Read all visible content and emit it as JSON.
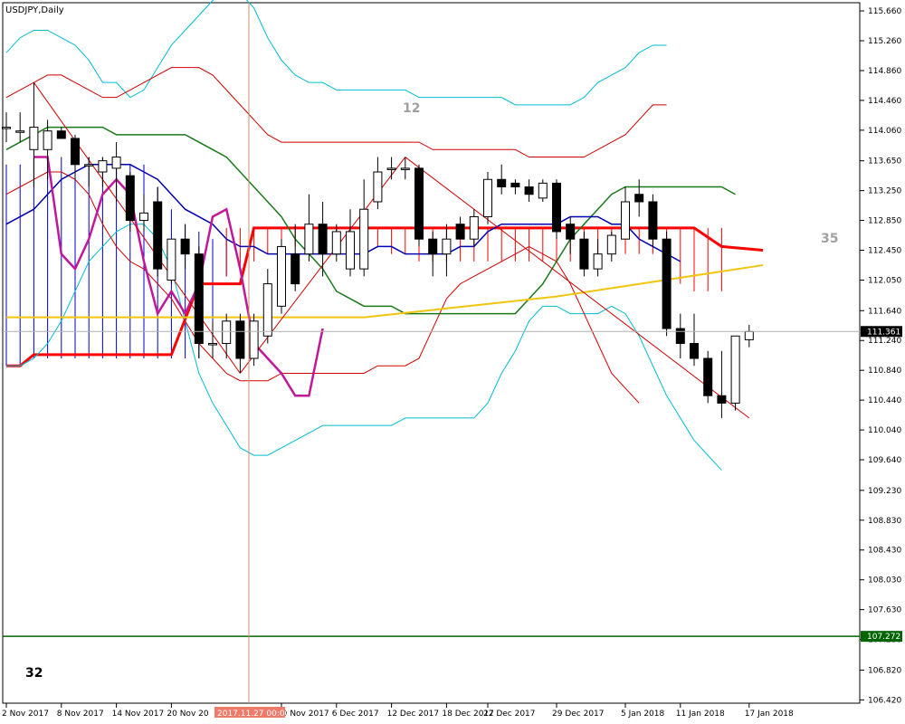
{
  "window": {
    "title": "USDJPY,Daily"
  },
  "colors": {
    "up_candle_fill": "#ffffff",
    "down_candle_fill": "#000000",
    "bollinger_outer": "#00bcd4",
    "bollinger_inner": "#d00000",
    "ma_green": "#1a7a1a",
    "ma_yellow": "#f2c40c",
    "ma_blue": "#0000b0",
    "magenta_line": "#c0189a",
    "cloud_blue": "#0000c8",
    "cloud_red": "#ff0000",
    "crosshair": "#c8906a",
    "support_line": "#006400",
    "price_badge": "#000000"
  },
  "annotations": {
    "label_12": "12",
    "label_35": "35",
    "label_32": "32"
  },
  "current_price_tag": "111.361",
  "support_price_tag": "107.272",
  "crosshair_date_tag": "2017.11.27 00:00",
  "chart_data": {
    "type": "candlestick",
    "title": "USDJPY,Daily",
    "xlabel": "",
    "ylabel": "",
    "ylim": [
      106.4,
      115.6
    ],
    "x_ticks": [
      "2 Nov 2017",
      "8 Nov 2017",
      "14 Nov 2017",
      "20 Nov 20",
      "30 Nov 2017",
      "6 Dec 2017",
      "12 Dec 2017",
      "18 Dec 2017",
      "22 Dec 2017",
      "29 Dec 2017",
      "5 Jan 2018",
      "11 Jan 2018",
      "17 Jan 2018"
    ],
    "y_ticks": [
      "115.660",
      "115.260",
      "114.860",
      "114.460",
      "114.060",
      "113.650",
      "113.250",
      "112.850",
      "112.450",
      "112.050",
      "111.640",
      "111.240",
      "110.840",
      "110.440",
      "110.040",
      "109.640",
      "109.230",
      "108.830",
      "108.430",
      "108.030",
      "107.630",
      "107.230",
      "106.820",
      "106.420"
    ],
    "candles": [
      {
        "o": 114.1,
        "h": 114.3,
        "l": 113.9,
        "c": 114.1
      },
      {
        "o": 114.05,
        "h": 114.3,
        "l": 113.9,
        "c": 114.05
      },
      {
        "o": 113.8,
        "h": 114.7,
        "l": 113.3,
        "c": 114.1
      },
      {
        "o": 113.8,
        "h": 114.2,
        "l": 113.4,
        "c": 114.05
      },
      {
        "o": 114.05,
        "h": 114.1,
        "l": 113.95,
        "c": 113.95
      },
      {
        "o": 113.95,
        "h": 114.0,
        "l": 113.4,
        "c": 113.6
      },
      {
        "o": 113.6,
        "h": 113.7,
        "l": 113.3,
        "c": 113.6
      },
      {
        "o": 113.5,
        "h": 113.7,
        "l": 113.3,
        "c": 113.65
      },
      {
        "o": 113.55,
        "h": 113.9,
        "l": 113.1,
        "c": 113.7
      },
      {
        "o": 113.45,
        "h": 113.5,
        "l": 112.7,
        "c": 112.85
      },
      {
        "o": 112.85,
        "h": 113.2,
        "l": 112.7,
        "c": 112.95
      },
      {
        "o": 113.1,
        "h": 113.3,
        "l": 112.1,
        "c": 112.2
      },
      {
        "o": 112.05,
        "h": 112.6,
        "l": 112.0,
        "c": 112.6
      },
      {
        "o": 112.6,
        "h": 112.8,
        "l": 112.2,
        "c": 112.4
      },
      {
        "o": 112.4,
        "h": 112.5,
        "l": 111.0,
        "c": 111.2
      },
      {
        "o": 111.2,
        "h": 111.5,
        "l": 111.0,
        "c": 111.2
      },
      {
        "o": 111.2,
        "h": 111.6,
        "l": 111.0,
        "c": 111.5
      },
      {
        "o": 111.5,
        "h": 111.6,
        "l": 110.8,
        "c": 111.0
      },
      {
        "o": 111.0,
        "h": 111.6,
        "l": 110.9,
        "c": 111.5
      },
      {
        "o": 111.3,
        "h": 112.2,
        "l": 111.2,
        "c": 112.0
      },
      {
        "o": 111.7,
        "h": 112.6,
        "l": 111.6,
        "c": 112.5
      },
      {
        "o": 112.4,
        "h": 112.8,
        "l": 111.9,
        "c": 112.0
      },
      {
        "o": 112.4,
        "h": 113.2,
        "l": 112.3,
        "c": 112.8
      },
      {
        "o": 112.8,
        "h": 113.1,
        "l": 112.1,
        "c": 112.4
      },
      {
        "o": 112.4,
        "h": 112.8,
        "l": 112.3,
        "c": 112.7
      },
      {
        "o": 112.2,
        "h": 113.0,
        "l": 112.1,
        "c": 112.7
      },
      {
        "o": 112.2,
        "h": 113.4,
        "l": 112.1,
        "c": 113.0
      },
      {
        "o": 113.1,
        "h": 113.7,
        "l": 113.0,
        "c": 113.5
      },
      {
        "o": 113.55,
        "h": 113.7,
        "l": 113.4,
        "c": 113.55
      },
      {
        "o": 113.55,
        "h": 113.7,
        "l": 113.4,
        "c": 113.55
      },
      {
        "o": 113.55,
        "h": 113.6,
        "l": 112.5,
        "c": 112.6
      },
      {
        "o": 112.6,
        "h": 112.7,
        "l": 112.1,
        "c": 112.4
      },
      {
        "o": 112.4,
        "h": 112.8,
        "l": 112.1,
        "c": 112.6
      },
      {
        "o": 112.8,
        "h": 112.9,
        "l": 112.6,
        "c": 112.6
      },
      {
        "o": 112.6,
        "h": 113.0,
        "l": 112.5,
        "c": 112.9
      },
      {
        "o": 112.9,
        "h": 113.5,
        "l": 112.8,
        "c": 113.4
      },
      {
        "o": 113.4,
        "h": 113.6,
        "l": 113.2,
        "c": 113.3
      },
      {
        "o": 113.35,
        "h": 113.4,
        "l": 113.2,
        "c": 113.3
      },
      {
        "o": 113.3,
        "h": 113.4,
        "l": 113.1,
        "c": 113.2
      },
      {
        "o": 113.15,
        "h": 113.4,
        "l": 113.1,
        "c": 113.35
      },
      {
        "o": 113.35,
        "h": 113.4,
        "l": 112.6,
        "c": 112.7
      },
      {
        "o": 112.8,
        "h": 112.9,
        "l": 112.4,
        "c": 112.6
      },
      {
        "o": 112.6,
        "h": 112.7,
        "l": 112.1,
        "c": 112.2
      },
      {
        "o": 112.2,
        "h": 112.6,
        "l": 112.1,
        "c": 112.4
      },
      {
        "o": 112.4,
        "h": 112.7,
        "l": 112.3,
        "c": 112.65
      },
      {
        "o": 112.6,
        "h": 113.3,
        "l": 112.6,
        "c": 113.1
      },
      {
        "o": 113.2,
        "h": 113.4,
        "l": 112.9,
        "c": 113.1
      },
      {
        "o": 113.1,
        "h": 113.2,
        "l": 112.5,
        "c": 112.6
      },
      {
        "o": 112.6,
        "h": 112.7,
        "l": 111.3,
        "c": 111.4
      },
      {
        "o": 111.4,
        "h": 111.6,
        "l": 111.0,
        "c": 111.2
      },
      {
        "o": 111.2,
        "h": 111.6,
        "l": 110.9,
        "c": 111.0
      },
      {
        "o": 111.0,
        "h": 111.1,
        "l": 110.4,
        "c": 110.5
      },
      {
        "o": 110.5,
        "h": 111.1,
        "l": 110.2,
        "c": 110.4
      },
      {
        "o": 110.4,
        "h": 111.3,
        "l": 110.3,
        "c": 111.3
      },
      {
        "o": 111.25,
        "h": 111.45,
        "l": 111.15,
        "c": 111.36
      }
    ],
    "current_price": 111.361,
    "support_level": 107.272,
    "crosshair_date": "2017.11.27 00:00"
  }
}
